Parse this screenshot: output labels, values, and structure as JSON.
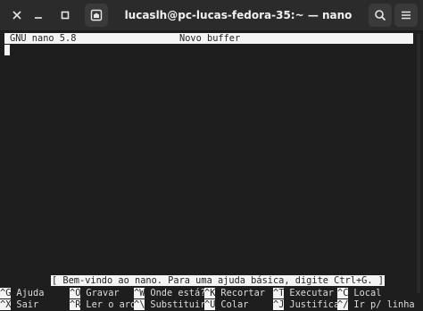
{
  "window": {
    "title": "lucaslh@pc-lucas-fedora-35:~ — nano"
  },
  "titlebar_buttons": {
    "left": [
      {
        "icon": "close-icon",
        "glyph": "✕"
      },
      {
        "icon": "minimize-icon",
        "glyph": "–"
      },
      {
        "icon": "maximize-icon",
        "glyph": "□"
      },
      {
        "icon": "new-tab-icon",
        "glyph": "⊞"
      }
    ],
    "right": [
      {
        "icon": "search-icon",
        "glyph": "⌕"
      },
      {
        "icon": "menu-icon",
        "glyph": "≡"
      }
    ]
  },
  "nano": {
    "version": "GNU nano 5.8",
    "buffer_name": "Novo buffer",
    "status_message": "[ Bem-vindo ao nano. Para uma ajuda básica, digite Ctrl+G. ]",
    "shortcuts_row1": [
      {
        "key": "^G",
        "label": "Ajuda"
      },
      {
        "key": "^O",
        "label": "Gravar"
      },
      {
        "key": "^W",
        "label": "Onde está?"
      },
      {
        "key": "^K",
        "label": "Recortar"
      },
      {
        "key": "^T",
        "label": "Executar"
      },
      {
        "key": "^C",
        "label": "Local"
      }
    ],
    "shortcuts_row2": [
      {
        "key": "^X",
        "label": "Sair"
      },
      {
        "key": "^R",
        "label": "Ler o arq"
      },
      {
        "key": "^\\",
        "label": "Substituir"
      },
      {
        "key": "^U",
        "label": "Colar"
      },
      {
        "key": "^J",
        "label": "Justificar"
      },
      {
        "key": "^/",
        "label": "Ir p/ linha"
      }
    ]
  },
  "colors": {
    "terminal_bg": "#1e1e1e",
    "titlebar_bg": "#2b2b2b",
    "highlight_bg": "#f4f4f4",
    "text": "#dcdcdc"
  }
}
